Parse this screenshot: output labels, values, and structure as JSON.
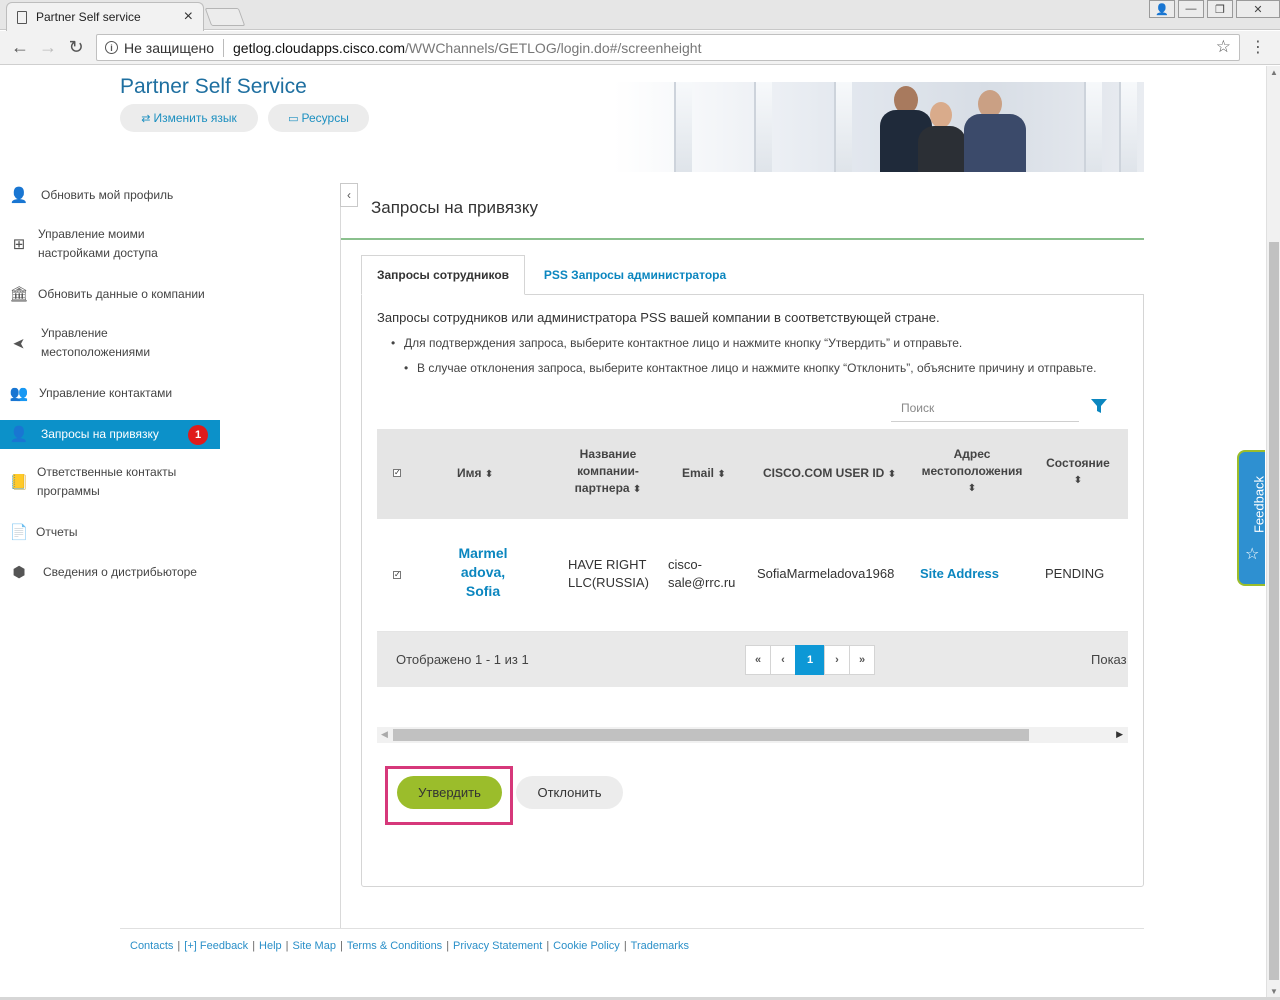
{
  "browser": {
    "tab_title": "Partner Self service",
    "tab_close": "×",
    "security_label": "Не защищено",
    "url_host": "getlog.cloudapps.cisco.com",
    "url_path": "/WWChannels/GETLOG/login.do#/screenheight",
    "back_icon": "←",
    "forward_icon": "→",
    "reload_icon": "↻",
    "star_icon": "☆",
    "menu_icon": "⋮",
    "win_user_icon": "👤",
    "win_min_icon": "—",
    "win_max_icon": "❐",
    "win_close_icon": "✕"
  },
  "header": {
    "title": "Partner Self Service",
    "change_language": "Изменить язык",
    "resources": "Ресурсы"
  },
  "sidebar": {
    "items": [
      {
        "label": "Обновить мой профиль",
        "icon": "user-icon",
        "glyph": "👤"
      },
      {
        "label": "Управление моими настройками доступа",
        "icon": "sitemap-icon",
        "glyph": "⊞"
      },
      {
        "label": "Обновить данные о компании",
        "icon": "bank-icon",
        "glyph": "🏛"
      },
      {
        "label": "Управление местоположениями",
        "icon": "location-arrow-icon",
        "glyph": "➤"
      },
      {
        "label": "Управление контактами",
        "icon": "users-icon",
        "glyph": "👥"
      },
      {
        "label": "Запросы на привязку",
        "icon": "user-plus-icon",
        "glyph": "👤",
        "badge": "1"
      },
      {
        "label": "Ответственные контакты программы",
        "icon": "book-icon",
        "glyph": "📒"
      },
      {
        "label": "Отчеты",
        "icon": "report-icon",
        "glyph": "📄"
      },
      {
        "label": "Сведения о дистрибьюторе",
        "icon": "cubes-icon",
        "glyph": "⬢"
      }
    ],
    "collapse_icon": "‹"
  },
  "main": {
    "heading": "Запросы на привязку",
    "tabs": [
      {
        "label": "Запросы сотрудников",
        "active": true
      },
      {
        "label": "PSS Запросы администратора",
        "active": false
      }
    ],
    "intro": "Запросы сотрудников или администратора PSS вашей компании в соответствующей стране.",
    "bullets": [
      "Для подтверждения запроса, выберите контактное лицо и нажмите кнопку “Утвердить” и отправьте.",
      "В случае отклонения запроса, выберите контактное лицо и нажмите кнопку “Отклонить”, объясните причину и отправьте."
    ],
    "search_placeholder": "Поиск",
    "table": {
      "columns": {
        "name": "Имя",
        "company": "Название компании-партнера",
        "company_l1": "Название",
        "company_l2": "компании-",
        "company_l3": "партнера",
        "email": "Email",
        "userid": "CISCO.COM USER ID",
        "address": "Адрес местоположения",
        "address_l1": "Адрес",
        "address_l2": "местоположения",
        "status": "Состояние"
      },
      "sort_icon": "⬍",
      "rows": [
        {
          "checked": true,
          "name": "Marmeladova, Sofia",
          "name_l1": "Marmel",
          "name_l2": "adova,",
          "name_l3": "Sofia",
          "company": "HAVE RIGHT LLC(RUSSIA)",
          "company_l1": "HAVE RIGHT",
          "company_l2": "LLC(RUSSIA)",
          "email": "cisco-sale@rrc.ru",
          "email_l1": "cisco-",
          "email_l2": "sale@rrc.ru",
          "userid": "SofiaMarmeladova1968",
          "address": "Site Address",
          "status": "PENDING"
        }
      ],
      "shown_text": "Отображено 1 - 1 из 1",
      "pager": {
        "first": "«",
        "prev": "‹",
        "current": "1",
        "next": "›",
        "last": "»"
      },
      "show_label": "Показ"
    },
    "approve": "Утвердить",
    "reject": "Отклонить"
  },
  "feedback_tab": "Feedback",
  "footer": {
    "links": [
      "Contacts",
      "[+] Feedback",
      "Help",
      "Site Map",
      "Terms & Conditions",
      "Privacy Statement",
      "Cookie Policy",
      "Trademarks"
    ]
  },
  "colors": {
    "brand_blue": "#0c91c9",
    "link_blue": "#0b86bf",
    "approve_green": "#9bbd2b",
    "highlight_pink": "#d6387a",
    "badge_red": "#e01b1b"
  }
}
